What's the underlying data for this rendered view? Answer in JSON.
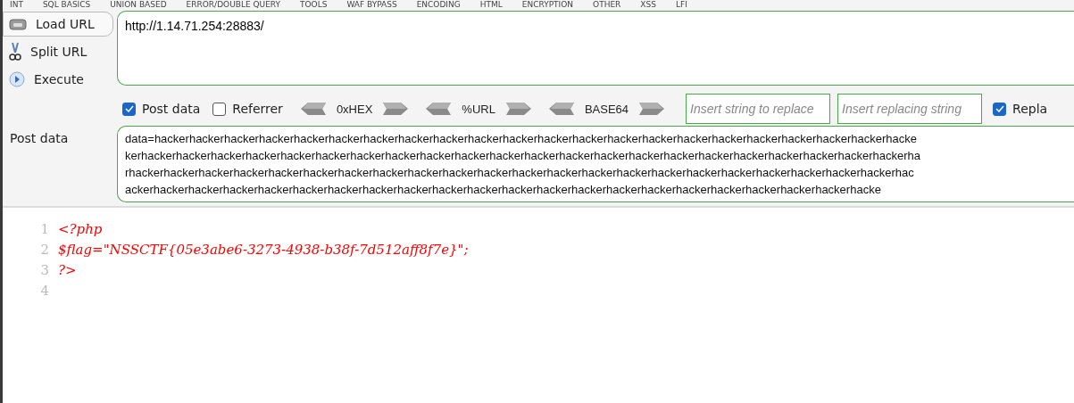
{
  "menu": [
    "INT",
    "SQL BASICS",
    "UNION BASED",
    "ERROR/DOUBLE QUERY",
    "TOOLS",
    "WAF BYPASS",
    "ENCODING",
    "HTML",
    "ENCRYPTION",
    "OTHER",
    "XSS",
    "LFI"
  ],
  "actions": [
    {
      "kind": "load",
      "label": "Load URL",
      "selected": true
    },
    {
      "kind": "split",
      "label": "Split URL",
      "selected": false
    },
    {
      "kind": "execute",
      "label": "Execute",
      "selected": false
    }
  ],
  "url": {
    "value": "http://1.14.71.254:28883/"
  },
  "options": [
    {
      "label": "Post data",
      "checked": true
    },
    {
      "label": "Referrer",
      "checked": false
    }
  ],
  "encoders": [
    "0xHEX",
    "%URL",
    "BASE64"
  ],
  "replace": {
    "find_placeholder": "Insert string to replace",
    "replace_placeholder": "Insert replacing string",
    "checkbox": {
      "label": "Repla",
      "checked": true
    }
  },
  "post_data": {
    "label": "Post data",
    "lines": [
      "data=hackerhackerhackerhackerhackerhackerhackerhackerhackerhackerhackerhackerhackerhackerhackerhackerhackerhackerhackerhackerhackerhacke",
      "kerhackerhackerhackerhackerhackerhackerhackerhackerhackerhackerhackerhackerhackerhackerhackerhackerhackerhackerhackerhackerhackerhackerha",
      "rhackerhackerhackerhackerhackerhackerhackerhackerhackerhackerhackerhackerhackerhackerhackerhackerhackerhackerhackerhackerhackerhackerhac",
      "ackerhackerhackerhackerhackerhackerhackerhackerhackerhackerhackerhackerhackerhackerhackerhackerhackerhackerhackerhackerhackerhacke"
    ]
  },
  "code": [
    {
      "number": "1",
      "text": "<?php"
    },
    {
      "number": "2",
      "text": "$flag=\"NSSCTF{05e3abe6-3273-4938-b38f-7d512aff8f7e}\";"
    },
    {
      "number": "3",
      "text": "?>"
    },
    {
      "number": "4"
    }
  ]
}
